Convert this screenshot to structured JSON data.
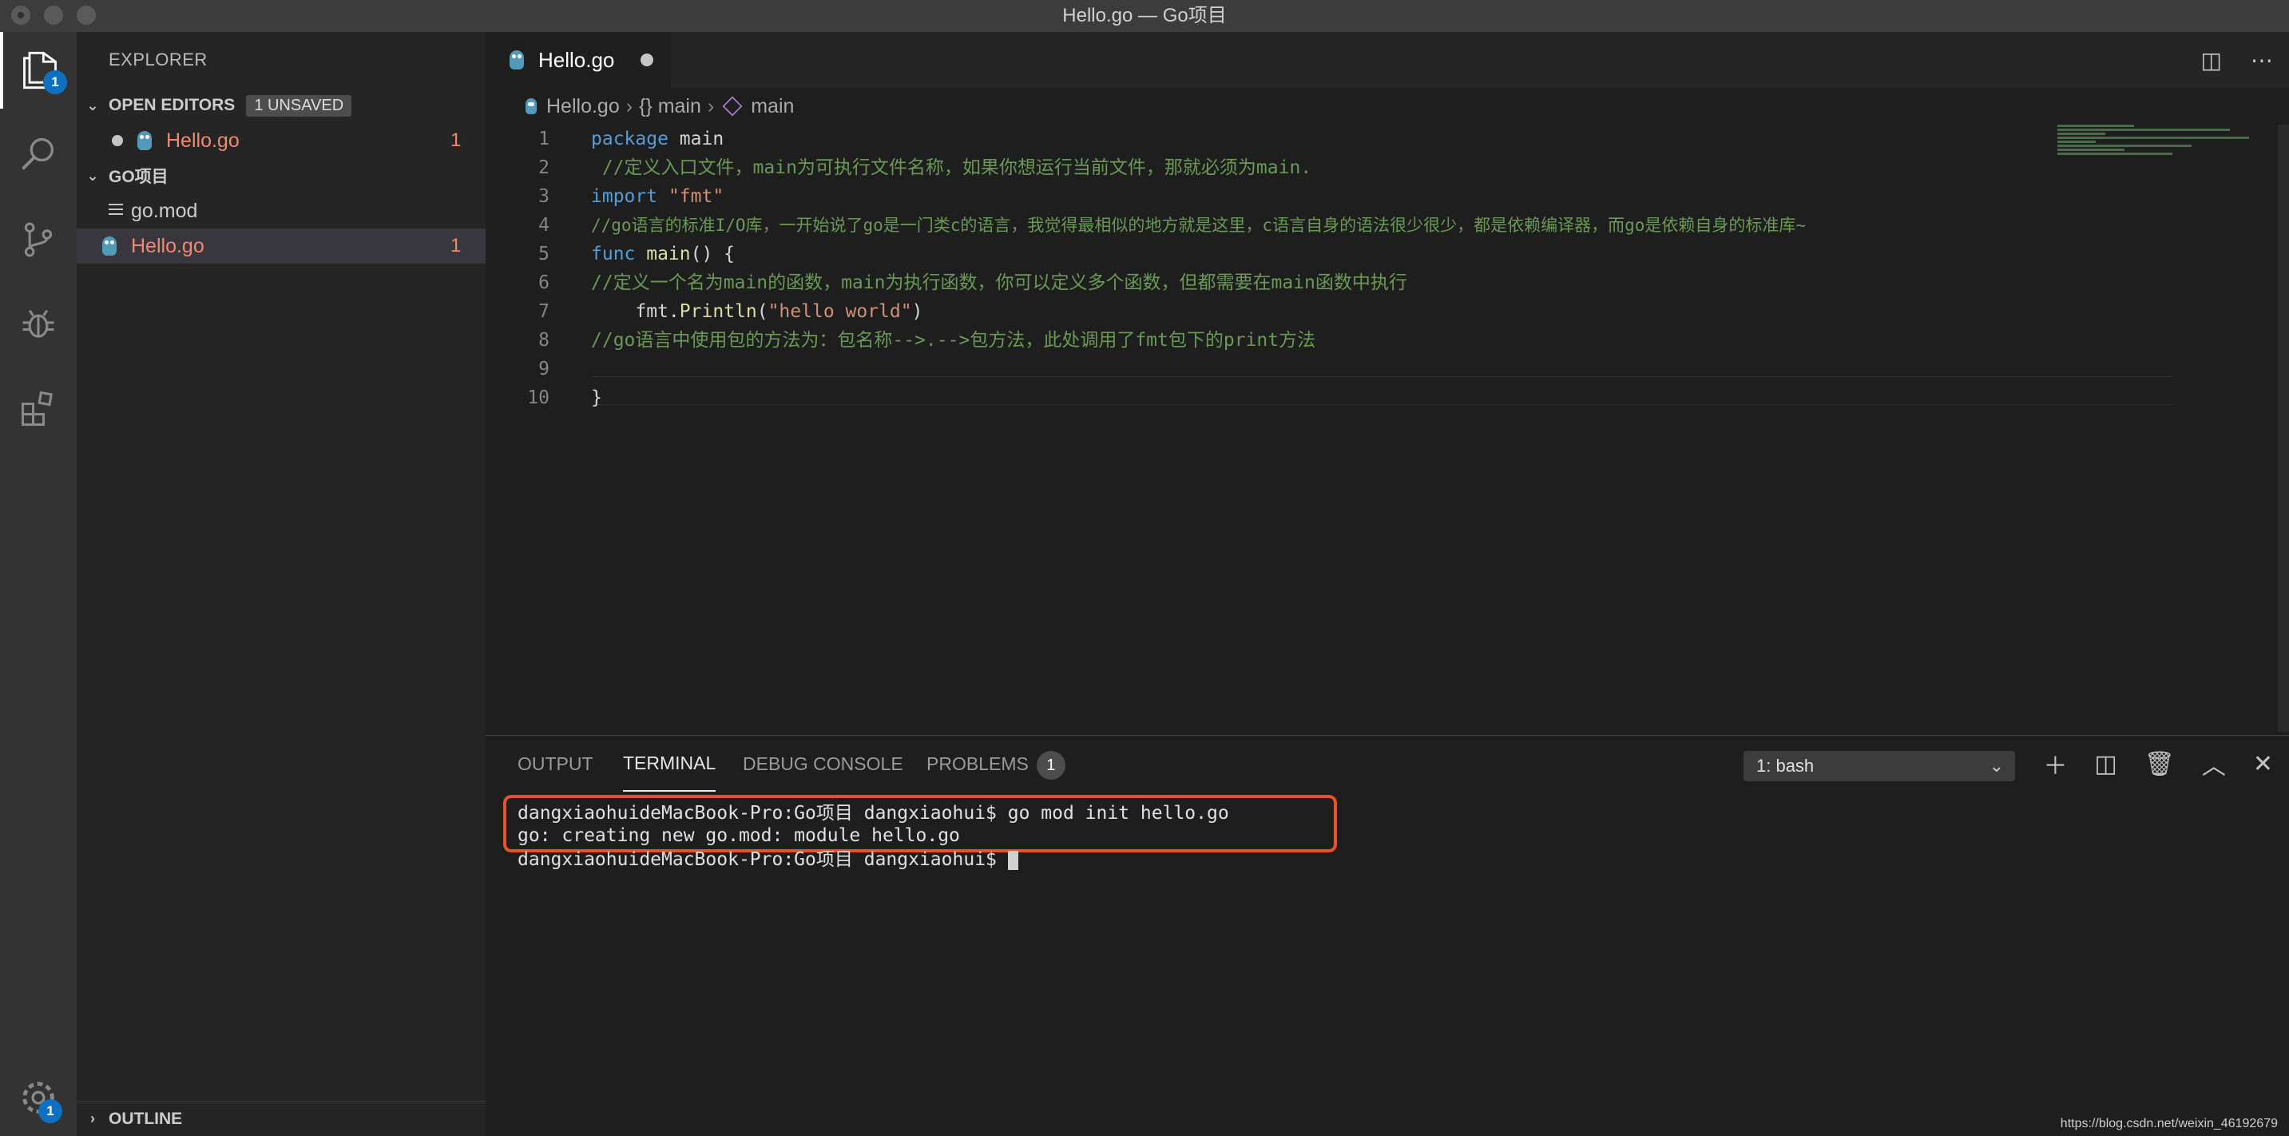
{
  "window": {
    "title": "Hello.go — Go项目"
  },
  "activity_bar": {
    "explorer_badge": "1",
    "settings_badge": "1"
  },
  "sidebar": {
    "title": "EXPLORER",
    "open_editors": {
      "label": "OPEN EDITORS",
      "unsaved": "1 UNSAVED",
      "items": [
        {
          "name": "Hello.go",
          "count": "1"
        }
      ]
    },
    "folder": {
      "label": "GO项目",
      "items": [
        {
          "name": "go.mod",
          "count": ""
        },
        {
          "name": "Hello.go",
          "count": "1"
        }
      ]
    },
    "outline_label": "OUTLINE"
  },
  "editor": {
    "tab_label": "Hello.go",
    "breadcrumb": {
      "file": "Hello.go",
      "namespace": "{} main",
      "symbol": "main"
    },
    "line_numbers": [
      "1",
      "2",
      "3",
      "4",
      "5",
      "6",
      "7",
      "8",
      "9",
      "10"
    ],
    "tokens": {
      "l1_kw": "package",
      "l1_rest": " main",
      "l2": " //定义入口文件，main为可执行文件名称，如果你想运行当前文件，那就必须为main.",
      "l3_kw": "import",
      "l3_str": " \"fmt\"",
      "l4": "//go语言的标准I/O库，一开始说了go是一门类c的语言，我觉得最相似的地方就是这里，c语言自身的语法很少很少，都是依赖编译器，而go是依赖自身的标准库~",
      "l5_kw": "func",
      "l5_fn": " main",
      "l5_rest": "() {",
      "l6": "//定义一个名为main的函数，main为执行函数，你可以定义多个函数，但都需要在main函数中执行",
      "l7_indent": "    fmt.",
      "l7_fn": "Println",
      "l7_p1": "(",
      "l7_str": "\"hello world\"",
      "l7_p2": ")",
      "l8": "//go语言中使用包的方法为：包名称-->.-->包方法，此处调用了fmt包下的print方法",
      "l10": "}"
    }
  },
  "panel": {
    "tabs": [
      "OUTPUT",
      "TERMINAL",
      "DEBUG CONSOLE",
      "PROBLEMS"
    ],
    "problems_count": "1",
    "terminal_select": "1: bash",
    "terminal_lines": [
      "dangxiaohuideMacBook-Pro:Go项目 dangxiaohui$ go mod init hello.go",
      "go: creating new go.mod: module hello.go",
      "dangxiaohuideMacBook-Pro:Go项目 dangxiaohui$ "
    ]
  },
  "watermark": "https://blog.csdn.net/weixin_46192679"
}
